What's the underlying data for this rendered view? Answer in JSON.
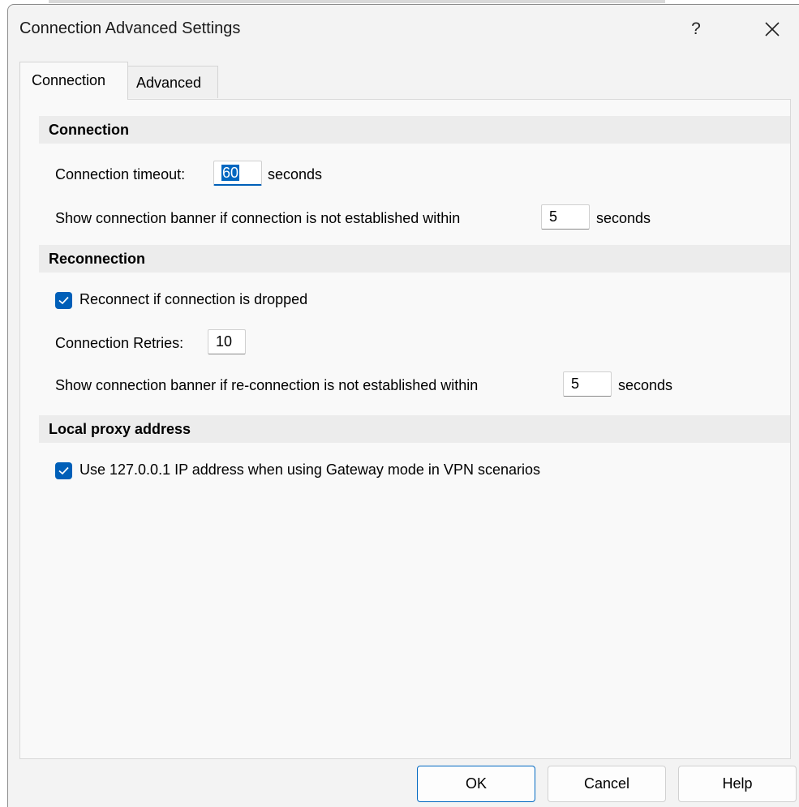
{
  "dialog": {
    "title": "Connection Advanced Settings",
    "help_label": "?",
    "close_icon": "close-icon"
  },
  "tabs": [
    {
      "label": "Connection",
      "active": true
    },
    {
      "label": "Advanced",
      "active": false
    }
  ],
  "sections": {
    "connection": {
      "heading": "Connection",
      "timeout_label": "Connection timeout:",
      "timeout_value": "60",
      "timeout_unit": "seconds",
      "banner_label": "Show connection banner if connection is not established within",
      "banner_value": "5",
      "banner_unit": "seconds"
    },
    "reconnection": {
      "heading": "Reconnection",
      "reconnect_label": "Reconnect if connection is dropped",
      "reconnect_checked": true,
      "retries_label": "Connection Retries:",
      "retries_value": "10",
      "banner_label": "Show connection banner if re-connection is not established within",
      "banner_value": "5",
      "banner_unit": "seconds"
    },
    "proxy": {
      "heading": "Local proxy address",
      "use_localhost_label": "Use 127.0.0.1 IP address when using Gateway mode in VPN scenarios",
      "use_localhost_checked": true
    }
  },
  "buttons": {
    "ok": "OK",
    "cancel": "Cancel",
    "help": "Help"
  },
  "colors": {
    "accent": "#005fb8",
    "selection": "#0067c0"
  }
}
